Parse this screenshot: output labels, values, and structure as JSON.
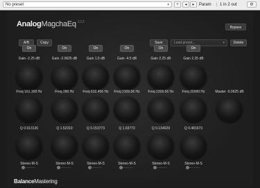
{
  "host": {
    "preset": "No preset",
    "param": "Param",
    "io": "1 in 2 out",
    "prev_glyph": "◂",
    "next_glyph": "▸",
    "plus": "+",
    "dropdown_glyph": "▾",
    "gear_glyph": "⚙"
  },
  "plugin": {
    "brand_bold": "Analog",
    "brand_rest": "MagchaEq",
    "version": "1.0.2",
    "bypass": "Bypass",
    "ab": "A/B",
    "copy": "Copy",
    "save": "Save",
    "load_placeholder": "Load preset...",
    "delete": "Delete",
    "footer_bold": "Balance",
    "footer_rest": "Mastering",
    "bands": [
      {
        "on": "On",
        "gain": "Gain -2.25 dB",
        "freq": "Freq 161.168 Hz",
        "q": "Q 0.913126",
        "stereo": "Stereo-M-S",
        "ms": 0
      },
      {
        "on": "On",
        "gain": "Gain -2.0625 dB",
        "freq": "Freq 280 Hz",
        "q": "Q 1.52319",
        "stereo": "Stereo-M-S",
        "ms": 0
      },
      {
        "on": "On",
        "gain": "Gain 1.5 dB",
        "freq": "Freq 632.456 Hz",
        "q": "Q 0.153773",
        "stereo": "Stereo-M-S",
        "ms": 0
      },
      {
        "on": "On",
        "gain": "Gain -4.5 dB",
        "freq": "Freq 2309.56 Hz",
        "q": "Q 1.03773",
        "stereo": "Stereo-M-S",
        "ms": 0
      },
      {
        "on": "On",
        "gain": "Gain 2.25 dB",
        "freq": "Freq 2309.56 Hz",
        "q": "Q 0.134029",
        "stereo": "Stereo-M-S",
        "ms": 0
      },
      {
        "on": "On",
        "gain": "Gain 2.25 dB",
        "freq": "Freq 20000 Hz",
        "q": "Q 0.481673",
        "stereo": "Stereo-M-S",
        "ms": 0
      }
    ],
    "master": "Master -0.0625 dB"
  }
}
